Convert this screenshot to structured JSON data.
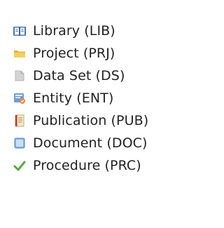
{
  "legend": {
    "items": [
      {
        "icon": "library-icon",
        "label": "Library (LIB)"
      },
      {
        "icon": "folder-icon",
        "label": "Project (PRJ)"
      },
      {
        "icon": "dataset-icon",
        "label": "Data Set (DS)"
      },
      {
        "icon": "entity-icon",
        "label": "Entity (ENT)"
      },
      {
        "icon": "publication-icon",
        "label": "Publication (PUB)"
      },
      {
        "icon": "document-icon",
        "label": "Document (DOC)"
      },
      {
        "icon": "checkmark-icon",
        "label": "Procedure (PRC)"
      }
    ]
  }
}
